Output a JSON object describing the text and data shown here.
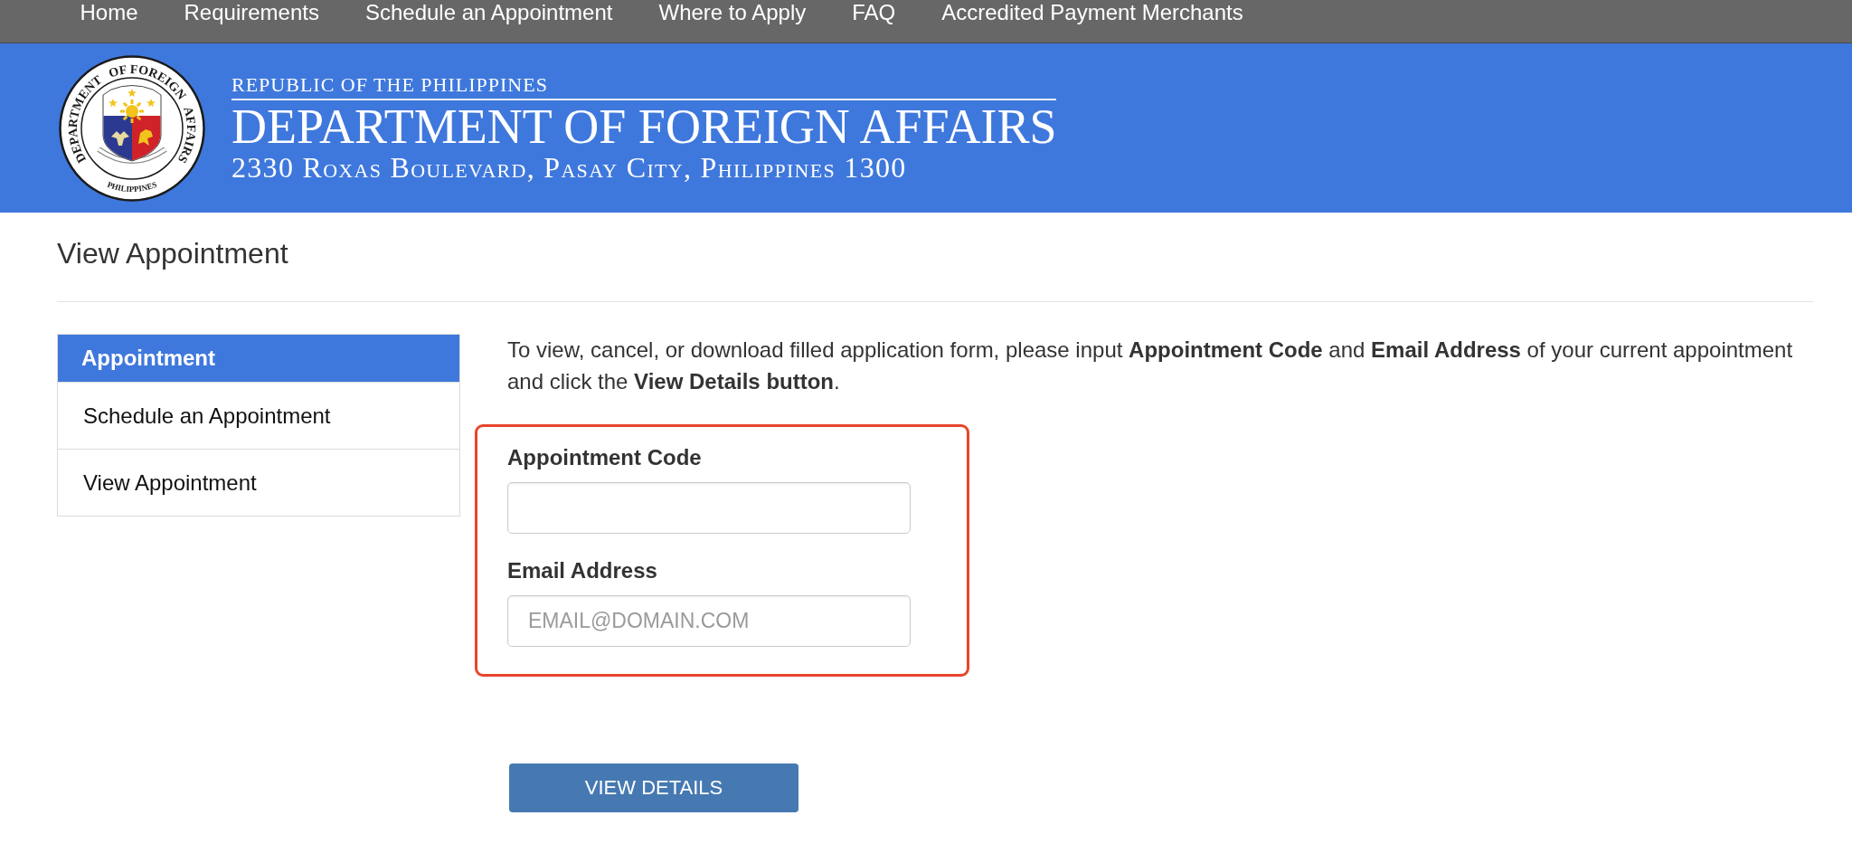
{
  "nav": {
    "items": [
      "Home",
      "Requirements",
      "Schedule an Appointment",
      "Where to Apply",
      "FAQ",
      "Accredited Payment Merchants"
    ]
  },
  "header": {
    "seal": {
      "ring_parts": [
        "DEPARTMENT",
        "OF FOREIGN",
        "AFFAIRS"
      ],
      "bottom_text": "PHILIPPINES"
    },
    "kicker": "REPUBLIC OF THE PHILIPPINES",
    "title": "DEPARTMENT OF FOREIGN AFFAIRS",
    "address": "2330 Roxas Boulevard, Pasay City, Philippines 1300"
  },
  "page_title": "View Appointment",
  "sidebar": {
    "heading": "Appointment",
    "items": [
      {
        "label": "Schedule an Appointment"
      },
      {
        "label": "View Appointment"
      }
    ]
  },
  "instructions": "To view, cancel, or download filled application form, please input **Appointment Code** and **Email Address** of your current appointment and click the **View Details button**.",
  "form": {
    "highlighted": true,
    "fields": [
      {
        "label": "Appointment Code"
      },
      {
        "label": "Email Address",
        "placeholder": "EMAIL@DOMAIN.COM"
      }
    ],
    "submit": "VIEW DETAILS"
  }
}
